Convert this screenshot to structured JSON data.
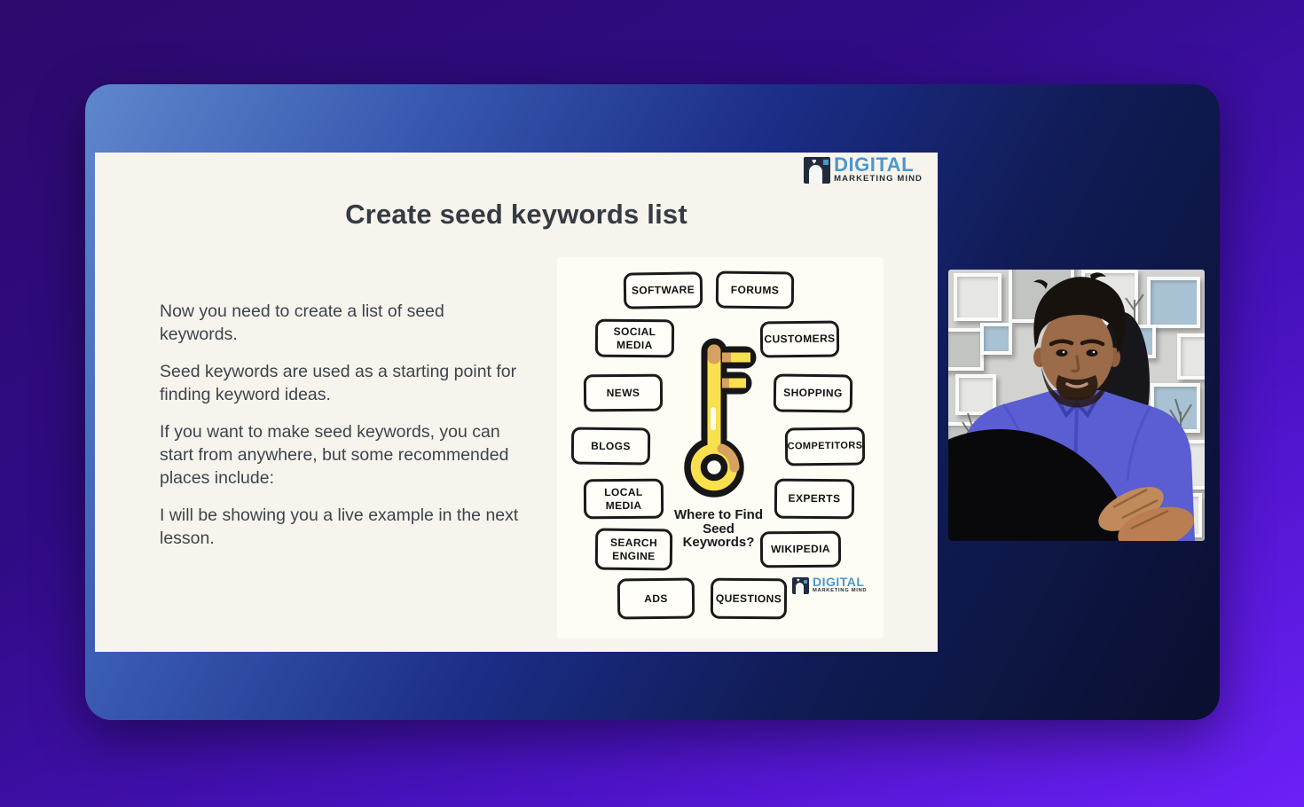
{
  "slide": {
    "title": "Create seed keywords list",
    "paragraphs": [
      "Now you need to create a list of seed keywords.",
      "Seed keywords are used as a starting point for finding keyword ideas.",
      "If you want to make seed keywords, you can start from anywhere, but some recommended places include:",
      "I will be showing you a live example in the next lesson."
    ],
    "brand": {
      "name": "DIGITAL",
      "tagline": "MARKETING MIND"
    }
  },
  "diagram": {
    "center_label_lines": [
      "Where to Find",
      "Seed",
      "Keywords?"
    ],
    "boxes": [
      {
        "label": "SOFTWARE"
      },
      {
        "label": "FORUMS"
      },
      {
        "label": "SOCIAL MEDIA"
      },
      {
        "label": "CUSTOMERS"
      },
      {
        "label": "NEWS"
      },
      {
        "label": "SHOPPING"
      },
      {
        "label": "BLOGS"
      },
      {
        "label": "COMPETITORS"
      },
      {
        "label": "LOCAL MEDIA"
      },
      {
        "label": "EXPERTS"
      },
      {
        "label": "SEARCH ENGINE"
      },
      {
        "label": "WIKIPEDIA"
      },
      {
        "label": "ADS"
      },
      {
        "label": "QUESTIONS"
      }
    ],
    "brand": {
      "name": "DIGITAL",
      "tagline": "MARKETING MIND"
    }
  },
  "colors": {
    "brand_blue": "#4a97cc",
    "brand_dark": "#262e38",
    "key_yellow": "#f8e04e",
    "key_tan": "#d7a15f",
    "key_outline": "#161616",
    "slide_bg": "#f7f4ed",
    "shirt_purple": "#5a5ed2"
  }
}
